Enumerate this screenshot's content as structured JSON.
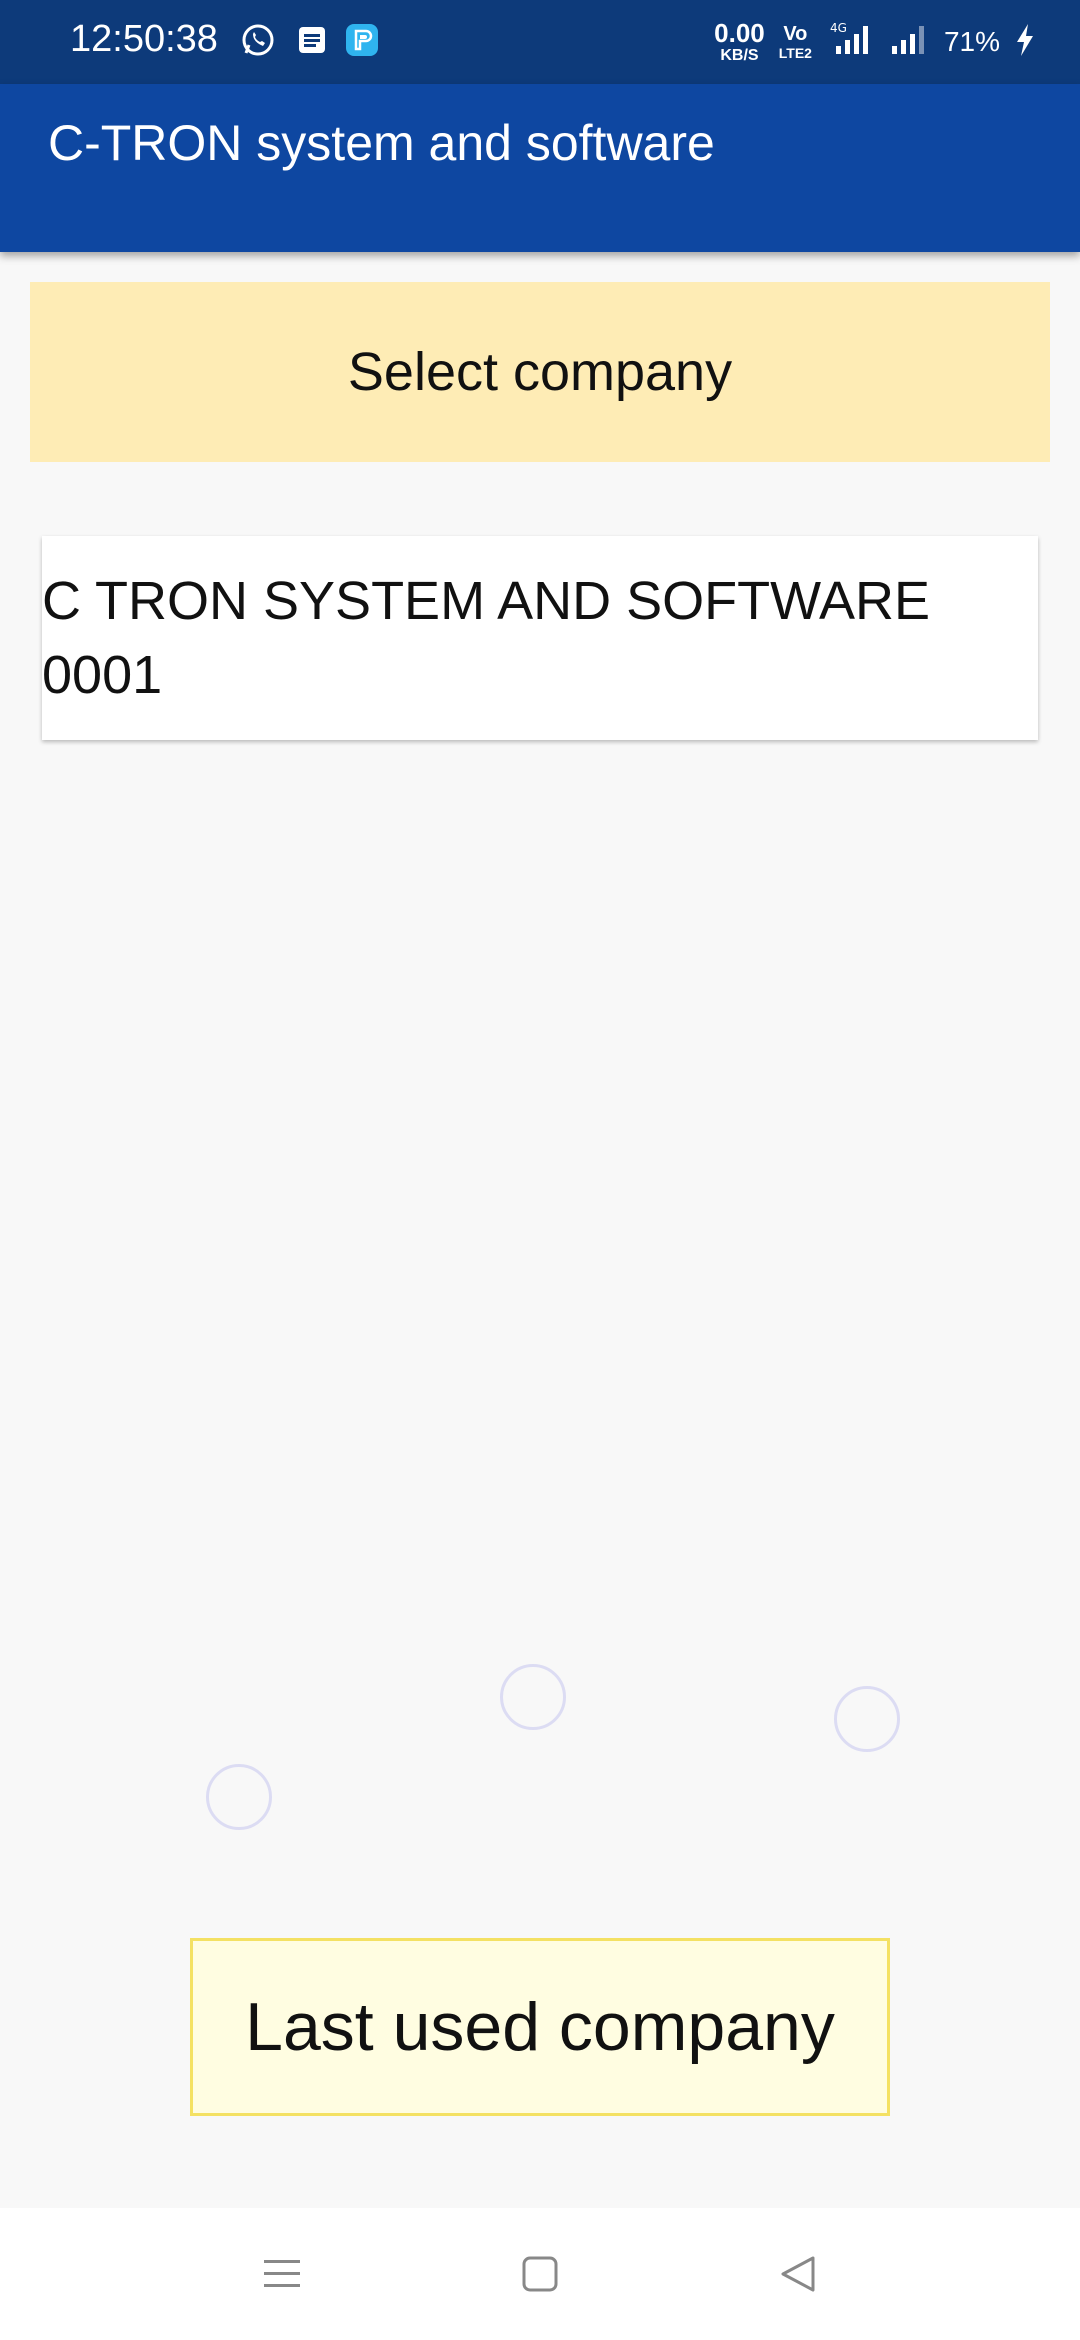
{
  "status_bar": {
    "time": "12:50:38",
    "net_speed_value": "0.00",
    "net_speed_unit": "KB/S",
    "volte_top": "Vo",
    "volte_bottom": "LTE2",
    "battery": "71%",
    "icons": [
      "whatsapp-icon",
      "notes-icon",
      "app-icon",
      "signal-4g-icon",
      "signal-icon",
      "charging-icon"
    ]
  },
  "app_bar": {
    "title": "C-TRON system and software"
  },
  "select_banner": {
    "label": "Select company"
  },
  "companies": [
    {
      "name": "C TRON SYSTEM AND SOFTWARE 0001"
    }
  ],
  "last_used_button": {
    "label": "Last used company"
  },
  "nav_bar": {
    "icons": [
      "menu-icon",
      "home-icon",
      "back-icon"
    ]
  },
  "colors": {
    "status_bar_bg": "#0d3a7a",
    "app_bar_bg": "#0e47a1",
    "banner_bg": "#feecb5",
    "last_used_bg": "#fffde1",
    "last_used_border": "#f4e163"
  }
}
